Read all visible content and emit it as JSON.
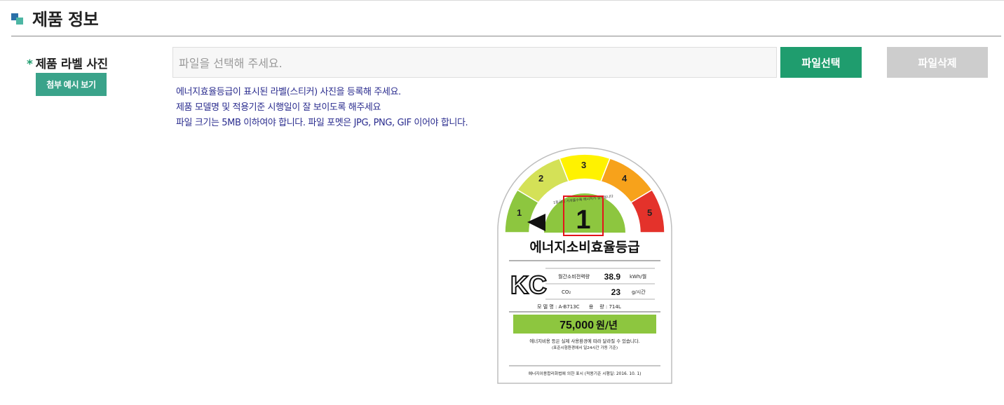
{
  "section": {
    "title": "제품 정보"
  },
  "field": {
    "required_mark": "*",
    "label": "제품 라벨 사진",
    "example_button": "첨부 예시 보기"
  },
  "file_input": {
    "placeholder": "파일을 선택해 주세요."
  },
  "buttons": {
    "select": "파일선택",
    "delete": "파일삭제"
  },
  "guide_lines": [
    "에너지효율등급이 표시된 라벨(스티커) 사진을 등록해 주세요.",
    "제품 모델명 및 적용기준 시행일이 잘 보이도록 해주세요",
    "파일 크기는 5MB 이하여야 합니다. 파일 포멧은 JPG, PNG, GIF 이어야 합니다."
  ],
  "label": {
    "grade_numbers": [
      "1",
      "2",
      "3",
      "4",
      "5"
    ],
    "grade": "1",
    "arc_text": "1등급에 가까울수록 에너지가 절약됩니다",
    "title": "에너지소비효율등급",
    "kc_mark": "KC",
    "rows": [
      {
        "name": "월간소비전력량",
        "value": "38.9",
        "unit": "kWh/월"
      },
      {
        "name": "CO₂",
        "value": "23",
        "unit": "g/시간"
      }
    ],
    "model_line": "모 델 명 : A-B713C      용    량 : 714L",
    "cost": {
      "value": "75,000",
      "unit": "원/년"
    },
    "note1": "에너지비용 등은 실제 사용환경에 따라 달라질 수 있습니다.",
    "note2": "(표준시험환경에서 일24시간 가동 기준)",
    "footer": "에너지이용합리화법에 의한 표시 (적용기준 시행일: 2016. 10. 1)",
    "colors": {
      "g1": "#8dc63f",
      "g2": "#d4e157",
      "g3": "#fff200",
      "g4": "#f7a21b",
      "g5": "#e4322b",
      "cost_bar": "#8dc63f",
      "highlight": "#e3141b"
    }
  }
}
